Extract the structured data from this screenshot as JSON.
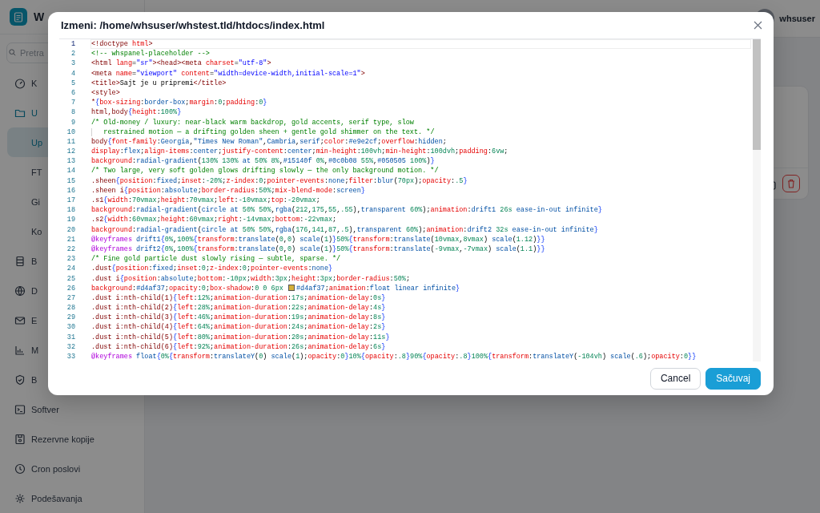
{
  "app": {
    "brand": "W",
    "search": {
      "placeholder": "Pretra"
    },
    "sidebar": {
      "items": [
        {
          "label": "K",
          "selected": false
        },
        {
          "label": "U",
          "selected": false,
          "expanded": true,
          "children": [
            {
              "label": "Up",
              "selected": true
            },
            {
              "label": "FT",
              "selected": false
            },
            {
              "label": "Gi",
              "selected": false
            },
            {
              "label": "Ko",
              "selected": false
            }
          ]
        },
        {
          "label": "B",
          "selected": false
        },
        {
          "label": "D",
          "selected": false
        },
        {
          "label": "E",
          "selected": false
        },
        {
          "label": "M",
          "selected": false
        },
        {
          "label": "B",
          "selected": false
        },
        {
          "label": "Softver",
          "selected": false
        },
        {
          "label": "Rezervne kopije",
          "selected": false
        },
        {
          "label": "Cron poslovi",
          "selected": false
        },
        {
          "label": "Podešavanja",
          "selected": false
        }
      ]
    },
    "user": {
      "name": "whsuser"
    }
  },
  "dialog": {
    "title": "Izmeni: /home/whsuser/whstest.tld/htdocs/index.html",
    "lines": [
      {
        "number": "1",
        "text": "<!doctype html>",
        "current": true
      },
      {
        "number": "2",
        "text": "<!-- whspanel-placeholder -->",
        "current": false
      },
      {
        "number": "3",
        "text": "<html lang=\"sr\"><head><meta charset=\"utf-8\">",
        "current": false
      },
      {
        "number": "4",
        "text": "<meta name=\"viewport\" content=\"width=device-width,initial-scale=1\">",
        "current": false
      },
      {
        "number": "5",
        "text": "<title>Sajt je u pripremi</title>",
        "current": false
      },
      {
        "number": "6",
        "text": "<style>",
        "current": false
      },
      {
        "number": "7",
        "text": "*{box-sizing:border-box;margin:0;padding:0}",
        "current": false
      },
      {
        "number": "8",
        "text": "html,body{height:100%}",
        "current": false
      },
      {
        "number": "9",
        "text": "/* Old-money / luxury: near-black warm backdrop, gold accents, serif type, slow",
        "current": false
      },
      {
        "number": "10",
        "text": "   restrained motion — a drifting golden sheen + gentle gold shimmer on the text. */",
        "current": false
      },
      {
        "number": "11",
        "text": "body{font-family:Georgia,\"Times New Roman\",Cambria,serif;color:#e9e2cf;overflow:hidden;",
        "current": false
      },
      {
        "number": "12",
        "text": "display:flex;align-items:center;justify-content:center;min-height:100vh;min-height:100dvh;padding:6vw;",
        "current": false
      },
      {
        "number": "13",
        "text": "background:radial-gradient(130% 130% at 50% 8%,#15140f 0%,#0c0b08 55%,#050505 100%)}",
        "current": false
      },
      {
        "number": "14",
        "text": "/* Two large, very soft golden glows drifting slowly — the only background motion. */",
        "current": false
      },
      {
        "number": "15",
        "text": ".sheen{position:fixed;inset:-20%;z-index:0;pointer-events:none;filter:blur(70px);opacity:.5}",
        "current": false
      },
      {
        "number": "16",
        "text": ".sheen i{position:absolute;border-radius:50%;mix-blend-mode:screen}",
        "current": false
      },
      {
        "number": "17",
        "text": ".s1{width:70vmax;height:70vmax;left:-10vmax;top:-20vmax;",
        "current": false
      },
      {
        "number": "18",
        "text": "background:radial-gradient(circle at 50% 50%,rgba(212,175,55,.55),transparent 60%);animation:drift1 26s ease-in-out infinite}",
        "current": false
      },
      {
        "number": "19",
        "text": ".s2{width:60vmax;height:60vmax;right:-14vmax;bottom:-22vmax;",
        "current": false
      },
      {
        "number": "20",
        "text": "background:radial-gradient(circle at 50% 50%,rgba(176,141,87,.5),transparent 60%);animation:drift2 32s ease-in-out infinite}",
        "current": false
      },
      {
        "number": "21",
        "text": "@keyframes drift1{0%,100%{transform:translate(0,0) scale(1)}50%{transform:translate(10vmax,8vmax) scale(1.12)}}",
        "current": false
      },
      {
        "number": "22",
        "text": "@keyframes drift2{0%,100%{transform:translate(0,0) scale(1)}50%{transform:translate(-9vmax,-7vmax) scale(1.1)}}",
        "current": false
      },
      {
        "number": "23",
        "text": "/* Fine gold particle dust slowly rising — subtle, sparse. */",
        "current": false
      },
      {
        "number": "24",
        "text": ".dust{position:fixed;inset:0;z-index:0;pointer-events:none}",
        "current": false
      },
      {
        "number": "25",
        "text": ".dust i{position:absolute;bottom:-10px;width:3px;height:3px;border-radius:50%;",
        "current": false
      },
      {
        "number": "26",
        "text": "background:#d4af37;opacity:0;box-shadow:0 0 6px #d4af37;animation:float linear infinite}",
        "current": false
      },
      {
        "number": "27",
        "text": ".dust i:nth-child(1){left:12%;animation-duration:17s;animation-delay:0s}",
        "current": false
      },
      {
        "number": "28",
        "text": ".dust i:nth-child(2){left:28%;animation-duration:22s;animation-delay:4s}",
        "current": false
      },
      {
        "number": "29",
        "text": ".dust i:nth-child(3){left:46%;animation-duration:19s;animation-delay:8s}",
        "current": false
      },
      {
        "number": "30",
        "text": ".dust i:nth-child(4){left:64%;animation-duration:24s;animation-delay:2s}",
        "current": false
      },
      {
        "number": "31",
        "text": ".dust i:nth-child(5){left:80%;animation-duration:20s;animation-delay:11s}",
        "current": false
      },
      {
        "number": "32",
        "text": ".dust i:nth-child(6){left:92%;animation-duration:26s;animation-delay:6s}",
        "current": false
      },
      {
        "number": "33",
        "text": "@keyframes float{0%{transform:translateY(0) scale(1);opacity:0}10%{opacity:.8}90%{opacity:.8}100%{transform:translateY(-104vh) scale(.6);opacity:0}}",
        "current": false
      }
    ],
    "buttons": [
      {
        "label": "Cancel",
        "kind": "secondary"
      },
      {
        "label": "Sačuvaj",
        "kind": "primary"
      }
    ]
  }
}
